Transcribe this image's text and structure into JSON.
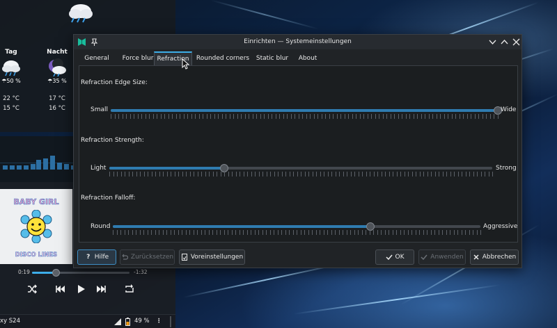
{
  "weather": {
    "days": [
      {
        "name": "Tag",
        "precip": "50 %",
        "high": "22 °C",
        "low": "15 °C",
        "icon": "cloudy-rain-icon"
      },
      {
        "name": "Nacht",
        "precip": "35 %",
        "high": "17 °C",
        "low": "16 °C",
        "icon": "night-cloudy-icon"
      }
    ],
    "top_icon": "cloudy-rain-icon"
  },
  "media": {
    "album_line1": "BABY GIRL",
    "album_line2": "DISCO LINES",
    "elapsed": "0:19",
    "remaining": "-1:32",
    "progress_fraction": 0.24
  },
  "taskbar": {
    "device": "xy S24",
    "battery": "49 %"
  },
  "dialog": {
    "title": "Einrichten — Systemeinstellungen",
    "tabs": [
      "General",
      "Force blur",
      "Refraction",
      "Rounded corners",
      "Static blur",
      "About"
    ],
    "active_tab": "Refraction",
    "sections": [
      {
        "label": "Refraction Edge Size:",
        "left": "Small",
        "right": "Wide",
        "value_fraction": 1.0
      },
      {
        "label": "Refraction Strength:",
        "left": "Light",
        "right": "Strong",
        "value_fraction": 0.3
      },
      {
        "label": "Refraction Falloff:",
        "left": "Round",
        "right": "Aggressive",
        "value_fraction": 0.7
      }
    ],
    "buttons": {
      "help": "Hilfe",
      "reset": "Zurücksetzen",
      "defaults": "Voreinstellungen",
      "ok": "OK",
      "apply": "Anwenden",
      "cancel": "Abbrechen"
    }
  },
  "colors": {
    "accent": "#3daee9",
    "slider_fill": "#2f7cb0",
    "window_bg": "#202326"
  }
}
